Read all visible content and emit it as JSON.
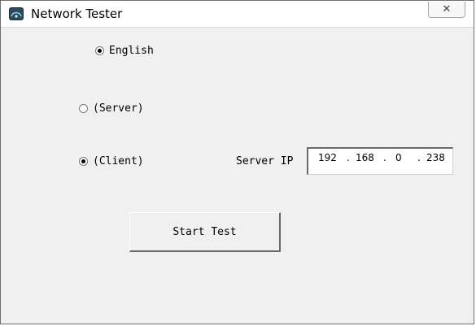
{
  "window": {
    "title": "Network Tester",
    "close_glyph": "✕",
    "icon": "network-app-icon"
  },
  "language": {
    "label": "English",
    "checked": true
  },
  "mode": {
    "server": {
      "label": "(Server)",
      "checked": false
    },
    "client": {
      "label": "(Client)",
      "checked": true
    }
  },
  "server_ip": {
    "label": "Server IP",
    "octets": [
      "192",
      "168",
      "0",
      "238"
    ]
  },
  "start_button": {
    "label": "Start Test"
  }
}
